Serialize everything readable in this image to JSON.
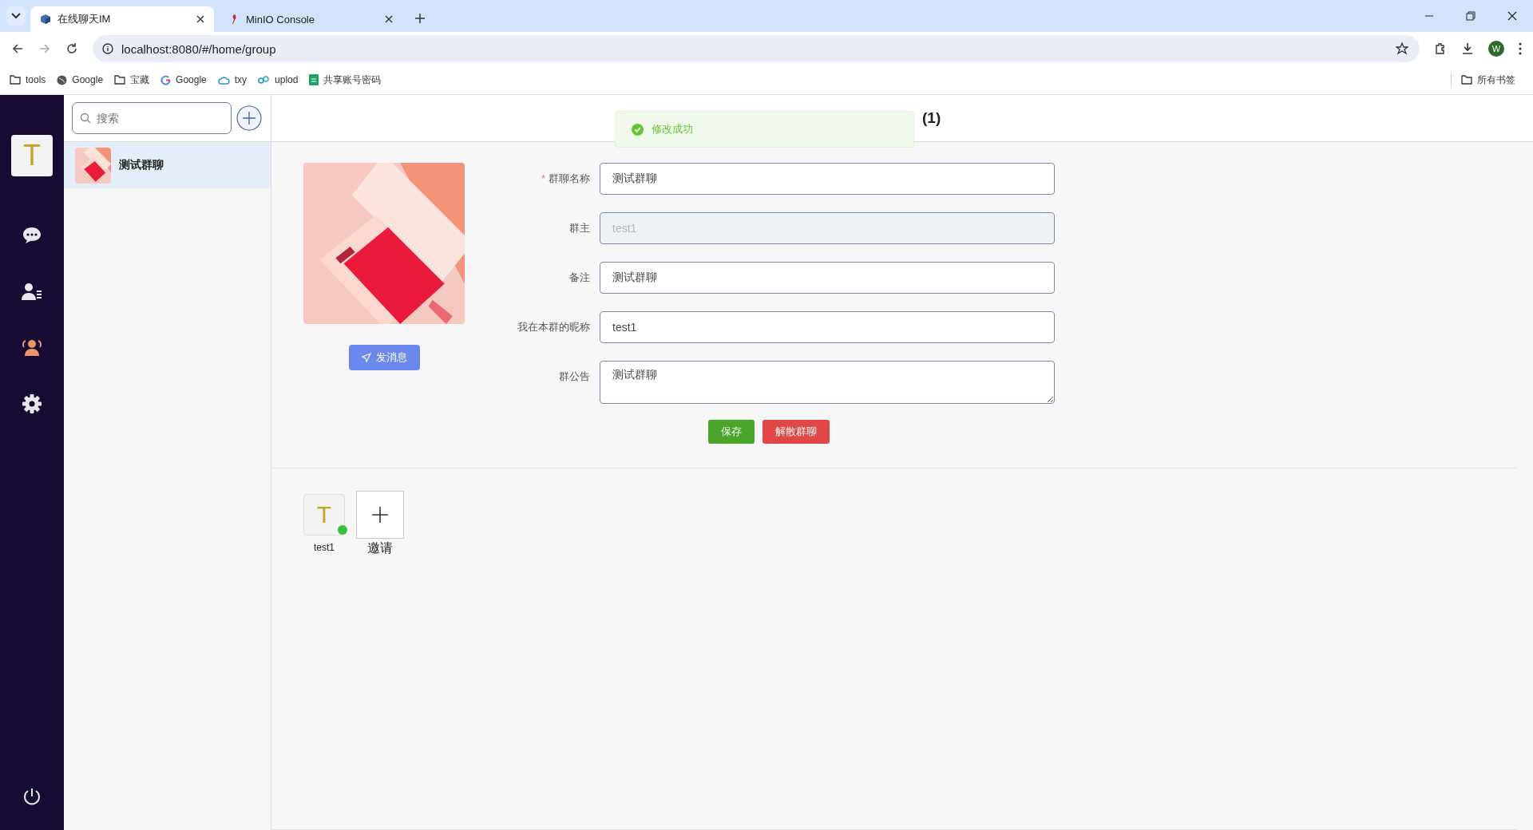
{
  "browser": {
    "tabs": [
      {
        "title": "在线聊天IM",
        "selected": true,
        "kind": "cube"
      },
      {
        "title": "MinIO Console",
        "selected": false,
        "kind": "bird"
      }
    ],
    "address": "localhost:8080/#/home/group",
    "profile": "W",
    "bookmarks": [
      {
        "label": "tools",
        "kind": "folder"
      },
      {
        "label": "Google",
        "kind": "globe"
      },
      {
        "label": "宝藏",
        "kind": "folder"
      },
      {
        "label": "Google",
        "kind": "google"
      },
      {
        "label": "txy",
        "kind": "cloud"
      },
      {
        "label": "uplod",
        "kind": "link"
      },
      {
        "label": "共享账号密码",
        "kind": "sheet"
      }
    ],
    "all_bookmarks": "所有书签"
  },
  "sidebar": {
    "avatar": "T",
    "nav": [
      {
        "kind": "chat",
        "selected": false
      },
      {
        "kind": "contacts",
        "selected": false
      },
      {
        "kind": "group",
        "selected": true
      },
      {
        "kind": "settings",
        "selected": false
      }
    ]
  },
  "search": {
    "placeholder": "搜索"
  },
  "groups": [
    {
      "name": "测试群聊",
      "selected": true,
      "kind": "picture"
    }
  ],
  "header": {
    "title": "(1)"
  },
  "toast": {
    "text": "修改成功",
    "kind": "success"
  },
  "send_button": "发消息",
  "fields": [
    {
      "mark": "*",
      "label": "群聊名称",
      "value": "测试群聊",
      "disabled": false,
      "kind": "input"
    },
    {
      "label": "群主",
      "value": "test1",
      "disabled": true,
      "kind": "input"
    },
    {
      "label": "备注",
      "value": "测试群聊",
      "disabled": false,
      "kind": "input"
    },
    {
      "label": "我在本群的昵称",
      "value": "test1",
      "disabled": false,
      "kind": "input"
    },
    {
      "label": "群公告",
      "value": "测试群聊",
      "disabled": false,
      "kind": "textarea"
    }
  ],
  "buttons": [
    {
      "label": "保存",
      "kind": "save"
    },
    {
      "label": "解散群聊",
      "kind": "danger"
    }
  ],
  "members": [
    {
      "name": "test1",
      "avatar": "T",
      "online": true
    }
  ],
  "invite": {
    "label": "邀请"
  }
}
